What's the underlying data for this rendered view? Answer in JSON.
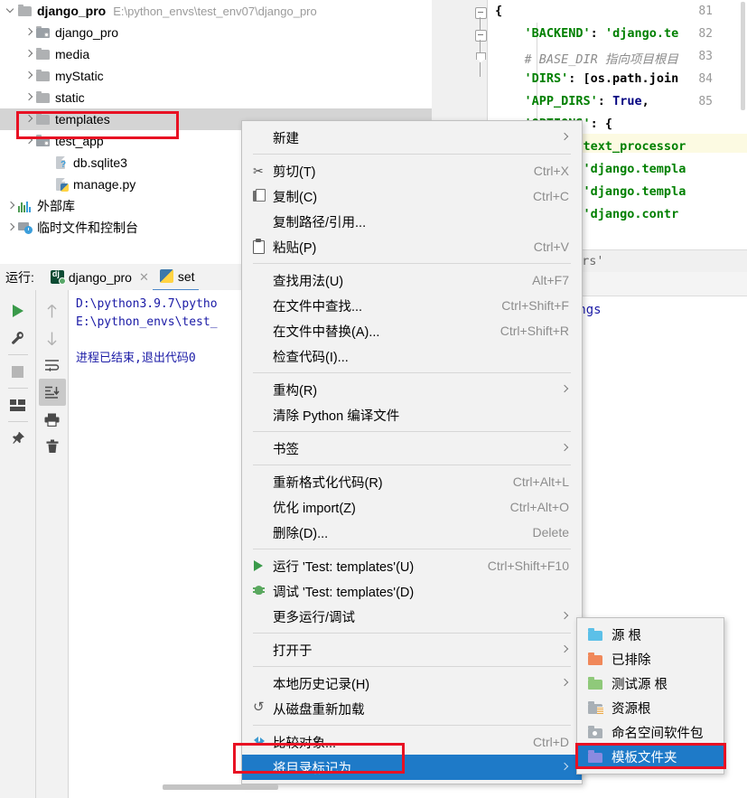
{
  "tree": {
    "rows": [
      {
        "indent": 0,
        "arrow": "down",
        "icon": "folder",
        "label": "django_pro",
        "bold": true,
        "path": "E:\\python_envs\\test_env07\\django_pro"
      },
      {
        "indent": 1,
        "arrow": "right",
        "icon": "folder-module",
        "label": "django_pro",
        "bold": false,
        "path": ""
      },
      {
        "indent": 1,
        "arrow": "right",
        "icon": "folder",
        "label": "media",
        "bold": false,
        "path": ""
      },
      {
        "indent": 1,
        "arrow": "right",
        "icon": "folder",
        "label": "myStatic",
        "bold": false,
        "path": ""
      },
      {
        "indent": 1,
        "arrow": "right",
        "icon": "folder",
        "label": "static",
        "bold": false,
        "path": ""
      },
      {
        "indent": 1,
        "arrow": "right",
        "icon": "folder",
        "label": "templates",
        "bold": false,
        "path": "",
        "selected": true
      },
      {
        "indent": 1,
        "arrow": "right",
        "icon": "folder-module",
        "label": "test_app",
        "bold": false,
        "path": ""
      },
      {
        "indent": 2,
        "arrow": "none",
        "icon": "file-db",
        "label": "db.sqlite3",
        "bold": false,
        "path": ""
      },
      {
        "indent": 2,
        "arrow": "none",
        "icon": "file-py",
        "label": "manage.py",
        "bold": false,
        "path": ""
      },
      {
        "indent": 0,
        "arrow": "right",
        "icon": "library",
        "label": "外部库",
        "bold": false,
        "path": ""
      },
      {
        "indent": 0,
        "arrow": "right",
        "icon": "scratch",
        "label": "临时文件和控制台",
        "bold": false,
        "path": ""
      }
    ]
  },
  "run_panel": {
    "label": "运行:",
    "tabs": [
      {
        "icon": "django-icon",
        "label": "django_pro",
        "closable": true,
        "active": false
      },
      {
        "icon": "python-icon",
        "label": "set",
        "closable": false,
        "active": true
      }
    ],
    "toolbar_left": [
      "run-icon",
      "wrench-icon",
      "stop-icon",
      "layout-icon",
      "pin-icon"
    ],
    "toolbar_right": [
      "up-arrow-icon",
      "down-arrow-icon",
      "soft-wrap-icon",
      "scroll-to-end-icon",
      "print-icon",
      "trash-icon"
    ],
    "console_lines": [
      "D:\\python3.9.7\\pytho",
      "E:\\python_envs\\test_",
      "",
      "进程已结束,退出代码0"
    ]
  },
  "editor": {
    "line_numbers": [
      "81",
      "82",
      "83",
      "84",
      "85"
    ],
    "lines": [
      {
        "segments": [
          {
            "text": "{",
            "cls": "s-pl"
          }
        ]
      },
      {
        "segments": [
          {
            "text": "    'BACKEND'",
            "cls": "s-str"
          },
          {
            "text": ": ",
            "cls": "s-pl"
          },
          {
            "text": "'django.te",
            "cls": "s-str"
          }
        ]
      },
      {
        "segments": [
          {
            "text": "    # BASE_DIR 指向项目根目",
            "cls": "s-cm"
          }
        ]
      },
      {
        "segments": [
          {
            "text": "    'DIRS'",
            "cls": "s-str"
          },
          {
            "text": ": [os.path.join",
            "cls": "s-pl"
          }
        ]
      },
      {
        "segments": [
          {
            "text": "    'APP_DIRS'",
            "cls": "s-str"
          },
          {
            "text": ": ",
            "cls": "s-pl"
          },
          {
            "text": "True",
            "cls": "s-kw"
          },
          {
            "text": ",",
            "cls": "s-pl"
          }
        ]
      },
      {
        "segments": [
          {
            "text": "    'OPTIONS'",
            "cls": "s-str"
          },
          {
            "text": ": {",
            "cls": "s-pl"
          }
        ]
      },
      {
        "segments": [
          {
            "text": "        'context_processor",
            "cls": "s-str"
          }
        ]
      },
      {
        "segments": [
          {
            "text": "            'django.templa",
            "cls": "s-str"
          }
        ]
      },
      {
        "segments": [
          {
            "text": "            'django.templa",
            "cls": "s-str"
          }
        ]
      },
      {
        "segments": [
          {
            "text": "            'django.contr",
            "cls": "s-str"
          }
        ]
      }
    ],
    "breadcrumb": "'context_processors'",
    "file_path_text": "/django_pro/settings"
  },
  "context_menu": {
    "items": [
      {
        "type": "item",
        "label": "新建",
        "icon": "",
        "accel": "",
        "submenu": true
      },
      {
        "type": "sep"
      },
      {
        "type": "item",
        "label": "剪切(T)",
        "icon": "scissors-icon",
        "accel": "Ctrl+X",
        "submenu": false,
        "mnemonic": "T"
      },
      {
        "type": "item",
        "label": "复制(C)",
        "icon": "copy-icon",
        "accel": "Ctrl+C",
        "submenu": false,
        "mnemonic": "C"
      },
      {
        "type": "item",
        "label": "复制路径/引用...",
        "icon": "",
        "accel": "",
        "submenu": false
      },
      {
        "type": "item",
        "label": "粘贴(P)",
        "icon": "paste-icon",
        "accel": "Ctrl+V",
        "submenu": false,
        "mnemonic": "P"
      },
      {
        "type": "sep"
      },
      {
        "type": "item",
        "label": "查找用法(U)",
        "icon": "",
        "accel": "Alt+F7",
        "submenu": false,
        "mnemonic": "U"
      },
      {
        "type": "item",
        "label": "在文件中查找...",
        "icon": "",
        "accel": "Ctrl+Shift+F",
        "submenu": false
      },
      {
        "type": "item",
        "label": "在文件中替换(A)...",
        "icon": "",
        "accel": "Ctrl+Shift+R",
        "submenu": false,
        "mnemonic": "A"
      },
      {
        "type": "item",
        "label": "检查代码(I)...",
        "icon": "",
        "accel": "",
        "submenu": false,
        "mnemonic": "I"
      },
      {
        "type": "sep"
      },
      {
        "type": "item",
        "label": "重构(R)",
        "icon": "",
        "accel": "",
        "submenu": true,
        "mnemonic": "R"
      },
      {
        "type": "item",
        "label": "清除 Python 编译文件",
        "icon": "",
        "accel": "",
        "submenu": false
      },
      {
        "type": "sep"
      },
      {
        "type": "item",
        "label": "书签",
        "icon": "",
        "accel": "",
        "submenu": true
      },
      {
        "type": "sep"
      },
      {
        "type": "item",
        "label": "重新格式化代码(R)",
        "icon": "",
        "accel": "Ctrl+Alt+L",
        "submenu": false,
        "mnemonic": "R"
      },
      {
        "type": "item",
        "label": "优化 import(Z)",
        "icon": "",
        "accel": "Ctrl+Alt+O",
        "submenu": false,
        "mnemonic": "Z"
      },
      {
        "type": "item",
        "label": "删除(D)...",
        "icon": "",
        "accel": "Delete",
        "submenu": false,
        "mnemonic": "D"
      },
      {
        "type": "sep"
      },
      {
        "type": "item",
        "label": "运行 'Test: templates'(U)",
        "icon": "run-icon",
        "accel": "Ctrl+Shift+F10",
        "submenu": false
      },
      {
        "type": "item",
        "label": "调试 'Test: templates'(D)",
        "icon": "debug-icon",
        "accel": "",
        "submenu": false
      },
      {
        "type": "item",
        "label": "更多运行/调试",
        "icon": "",
        "accel": "",
        "submenu": true
      },
      {
        "type": "sep"
      },
      {
        "type": "item",
        "label": "打开于",
        "icon": "",
        "accel": "",
        "submenu": true
      },
      {
        "type": "sep"
      },
      {
        "type": "item",
        "label": "本地历史记录(H)",
        "icon": "",
        "accel": "",
        "submenu": true,
        "mnemonic": "H"
      },
      {
        "type": "item",
        "label": "从磁盘重新加载",
        "icon": "reload-icon",
        "accel": "",
        "submenu": false
      },
      {
        "type": "sep"
      },
      {
        "type": "item",
        "label": "比较对象...",
        "icon": "compare-icon",
        "accel": "Ctrl+D",
        "submenu": false
      },
      {
        "type": "item",
        "label": "将目录标记为",
        "icon": "",
        "accel": "",
        "submenu": true,
        "highlighted": true
      }
    ]
  },
  "submenu": {
    "items": [
      {
        "label": "源 根",
        "color": "#5cc0e8",
        "icon": "folder-source-root"
      },
      {
        "label": "已排除",
        "color": "#f0885a",
        "icon": "folder-excluded"
      },
      {
        "label": "测试源 根",
        "color": "#8fc97a",
        "icon": "folder-test-source-root"
      },
      {
        "label": "资源根",
        "color": "#a9b0b6",
        "icon": "folder-resource-root"
      },
      {
        "label": "命名空间软件包",
        "color": "#a9b0b6",
        "icon": "folder-namespace-package"
      },
      {
        "label": "模板文件夹",
        "color": "#8a8ae0",
        "icon": "folder-template",
        "highlighted": true
      }
    ]
  },
  "annotations": {
    "highlight_color": "#e81123",
    "boxes": [
      "templates-tree-row",
      "mark-directory-as-item",
      "template-folder-submenu-item"
    ]
  }
}
